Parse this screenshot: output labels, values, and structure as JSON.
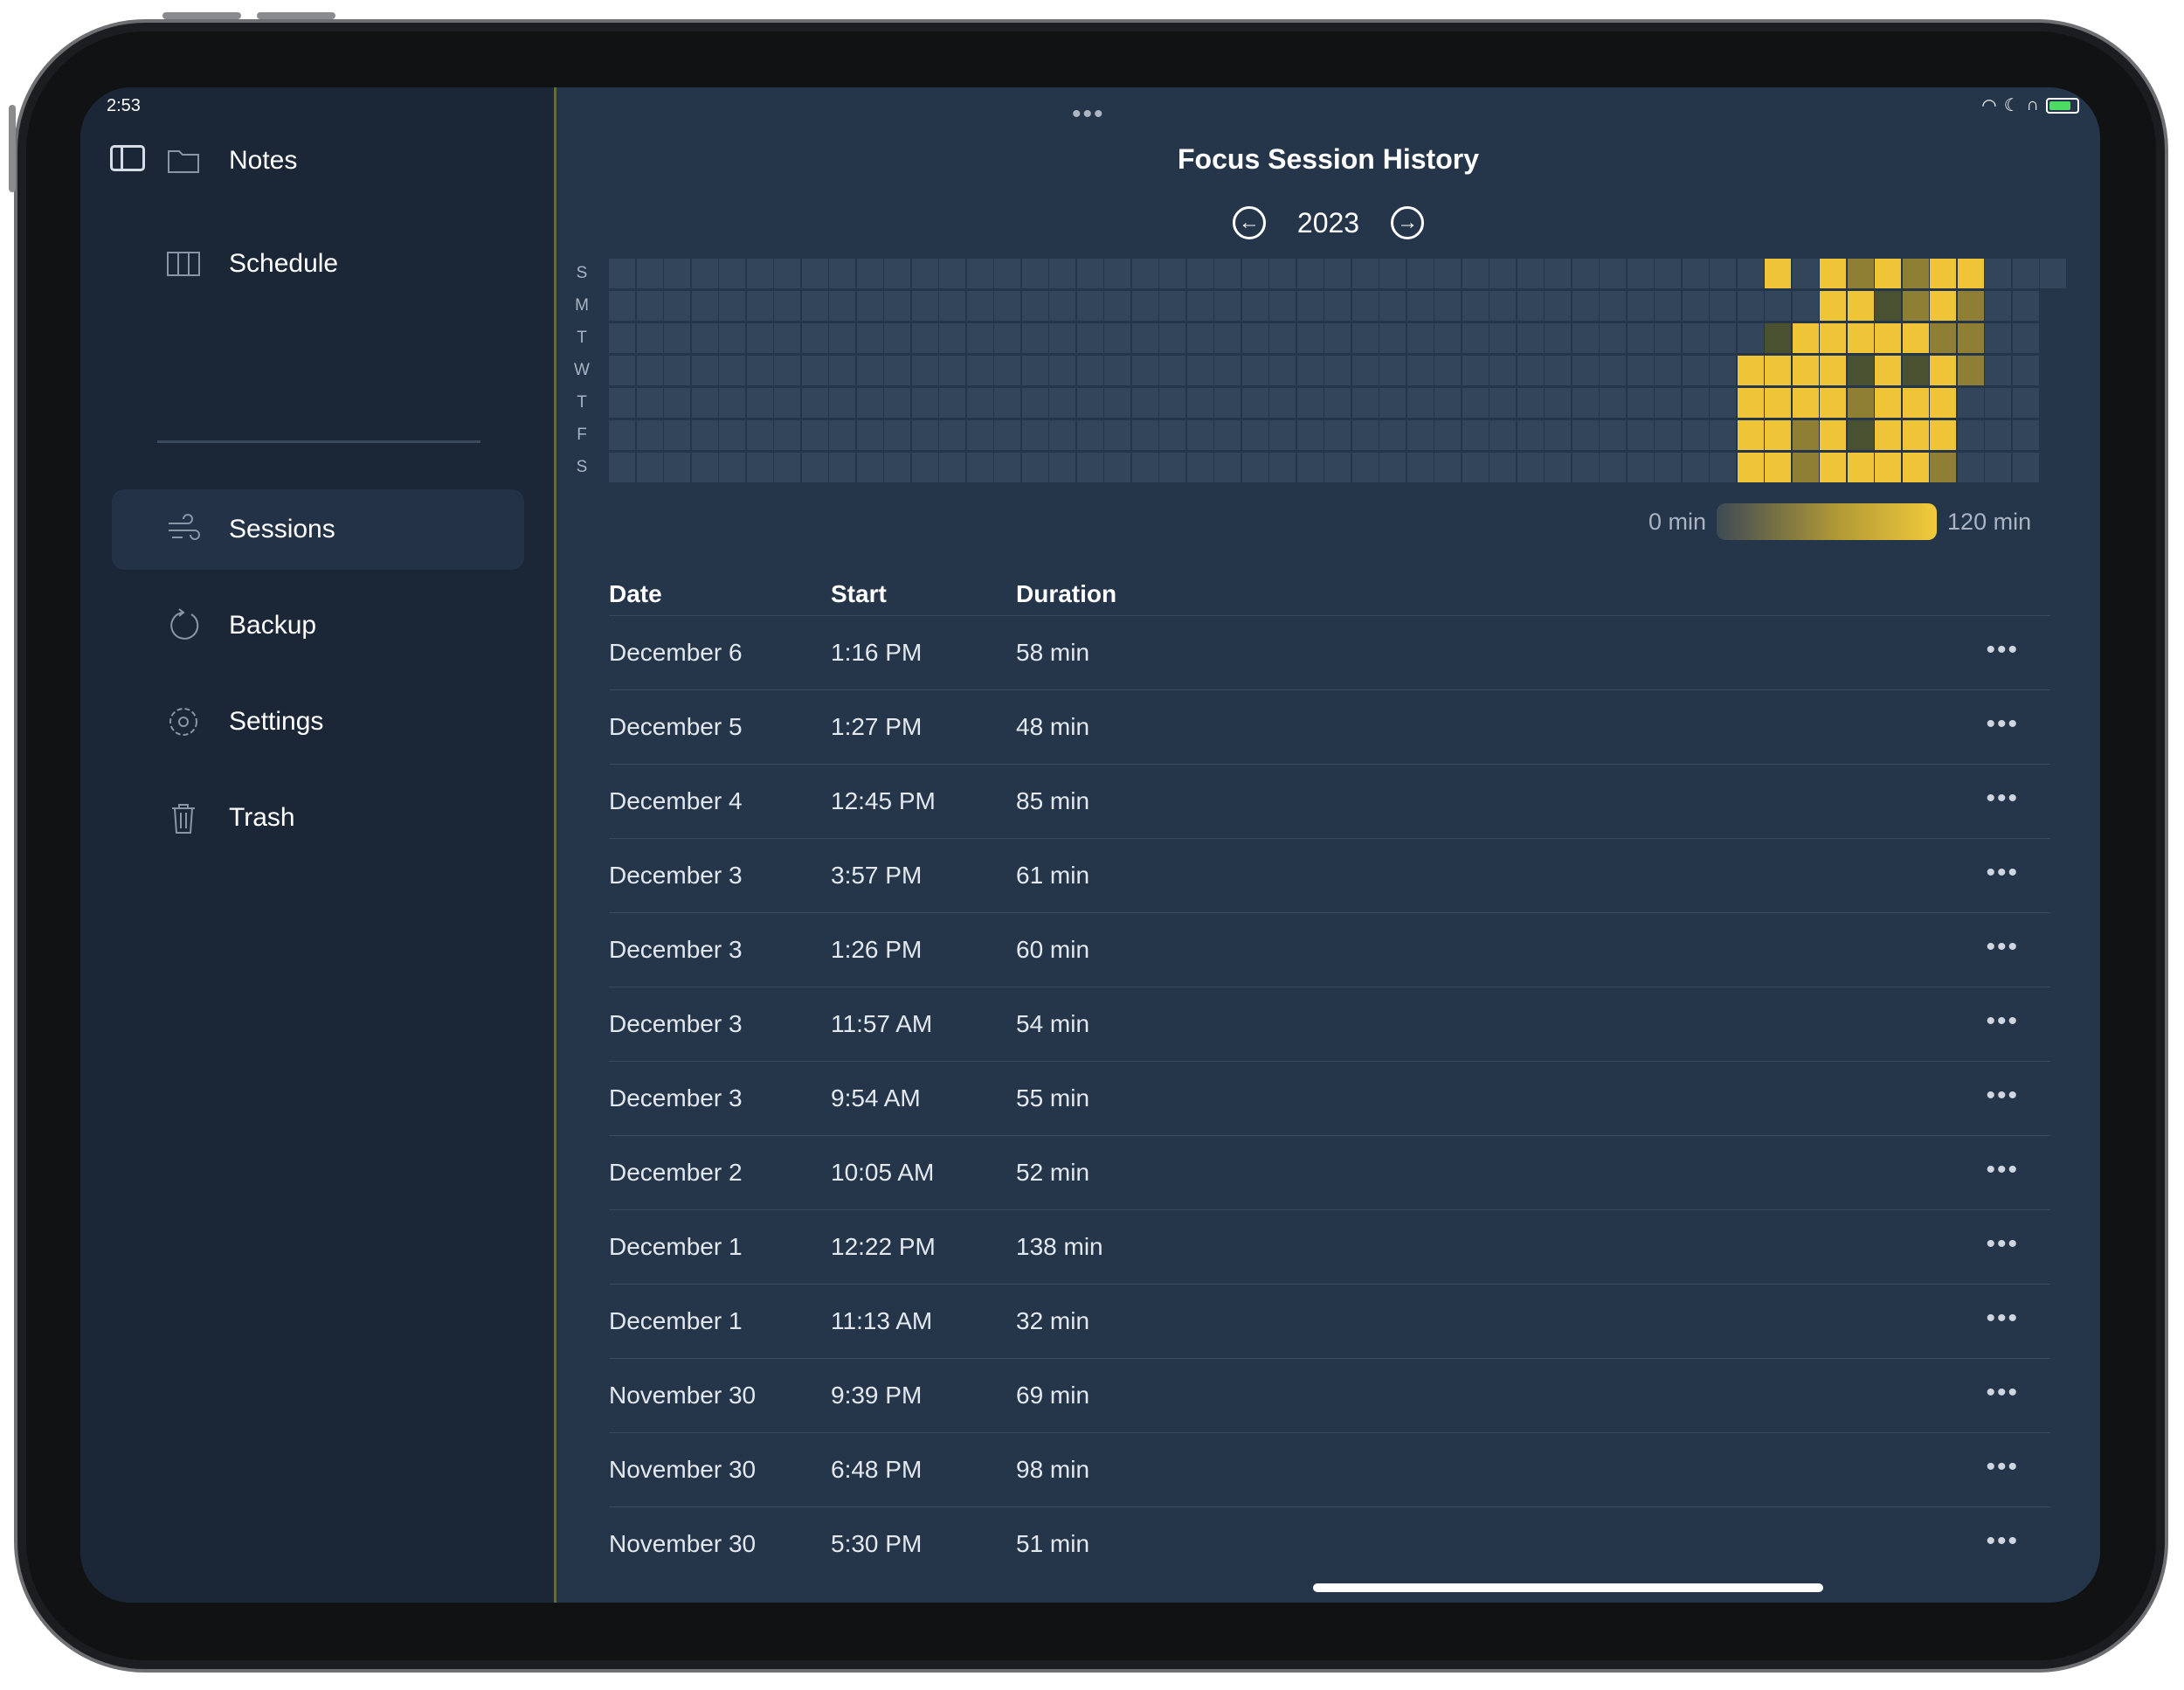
{
  "status": {
    "time": "2:53"
  },
  "sidebar": {
    "top_items": [
      {
        "label": "Notes",
        "icon": "folder-icon"
      },
      {
        "label": "Schedule",
        "icon": "columns-icon"
      }
    ],
    "items": [
      {
        "label": "Sessions",
        "icon": "wind-icon",
        "active": true
      },
      {
        "label": "Backup",
        "icon": "refresh-icon"
      },
      {
        "label": "Settings",
        "icon": "gear-icon"
      },
      {
        "label": "Trash",
        "icon": "trash-icon"
      }
    ]
  },
  "header": {
    "title": "Focus Session History",
    "year": "2023",
    "prev_icon": "arrow-left-circle-icon",
    "next_icon": "arrow-right-circle-icon"
  },
  "heatmap": {
    "day_labels": [
      "S",
      "M",
      "T",
      "W",
      "T",
      "F",
      "S"
    ],
    "legend_min": "0 min",
    "legend_max": "120 min",
    "colors": {
      "empty": "#33455a",
      "low": "#4a5130",
      "mid": "#8f7f35",
      "high": "#efc437"
    }
  },
  "table": {
    "headers": {
      "date": "Date",
      "start": "Start",
      "duration": "Duration"
    },
    "rows": [
      {
        "date": "December 6",
        "start": "1:16 PM",
        "duration": "58 min"
      },
      {
        "date": "December 5",
        "start": "1:27 PM",
        "duration": "48 min"
      },
      {
        "date": "December 4",
        "start": "12:45 PM",
        "duration": "85 min"
      },
      {
        "date": "December 3",
        "start": "3:57 PM",
        "duration": "61 min"
      },
      {
        "date": "December 3",
        "start": "1:26 PM",
        "duration": "60 min"
      },
      {
        "date": "December 3",
        "start": "11:57 AM",
        "duration": "54 min"
      },
      {
        "date": "December 3",
        "start": "9:54 AM",
        "duration": "55 min"
      },
      {
        "date": "December 2",
        "start": "10:05 AM",
        "duration": "52 min"
      },
      {
        "date": "December 1",
        "start": "12:22 PM",
        "duration": "138 min"
      },
      {
        "date": "December 1",
        "start": "11:13 AM",
        "duration": "32 min"
      },
      {
        "date": "November 30",
        "start": "9:39 PM",
        "duration": "69 min"
      },
      {
        "date": "November 30",
        "start": "6:48 PM",
        "duration": "98 min"
      },
      {
        "date": "November 30",
        "start": "5:30 PM",
        "duration": "51 min"
      }
    ],
    "more_label": "•••"
  }
}
